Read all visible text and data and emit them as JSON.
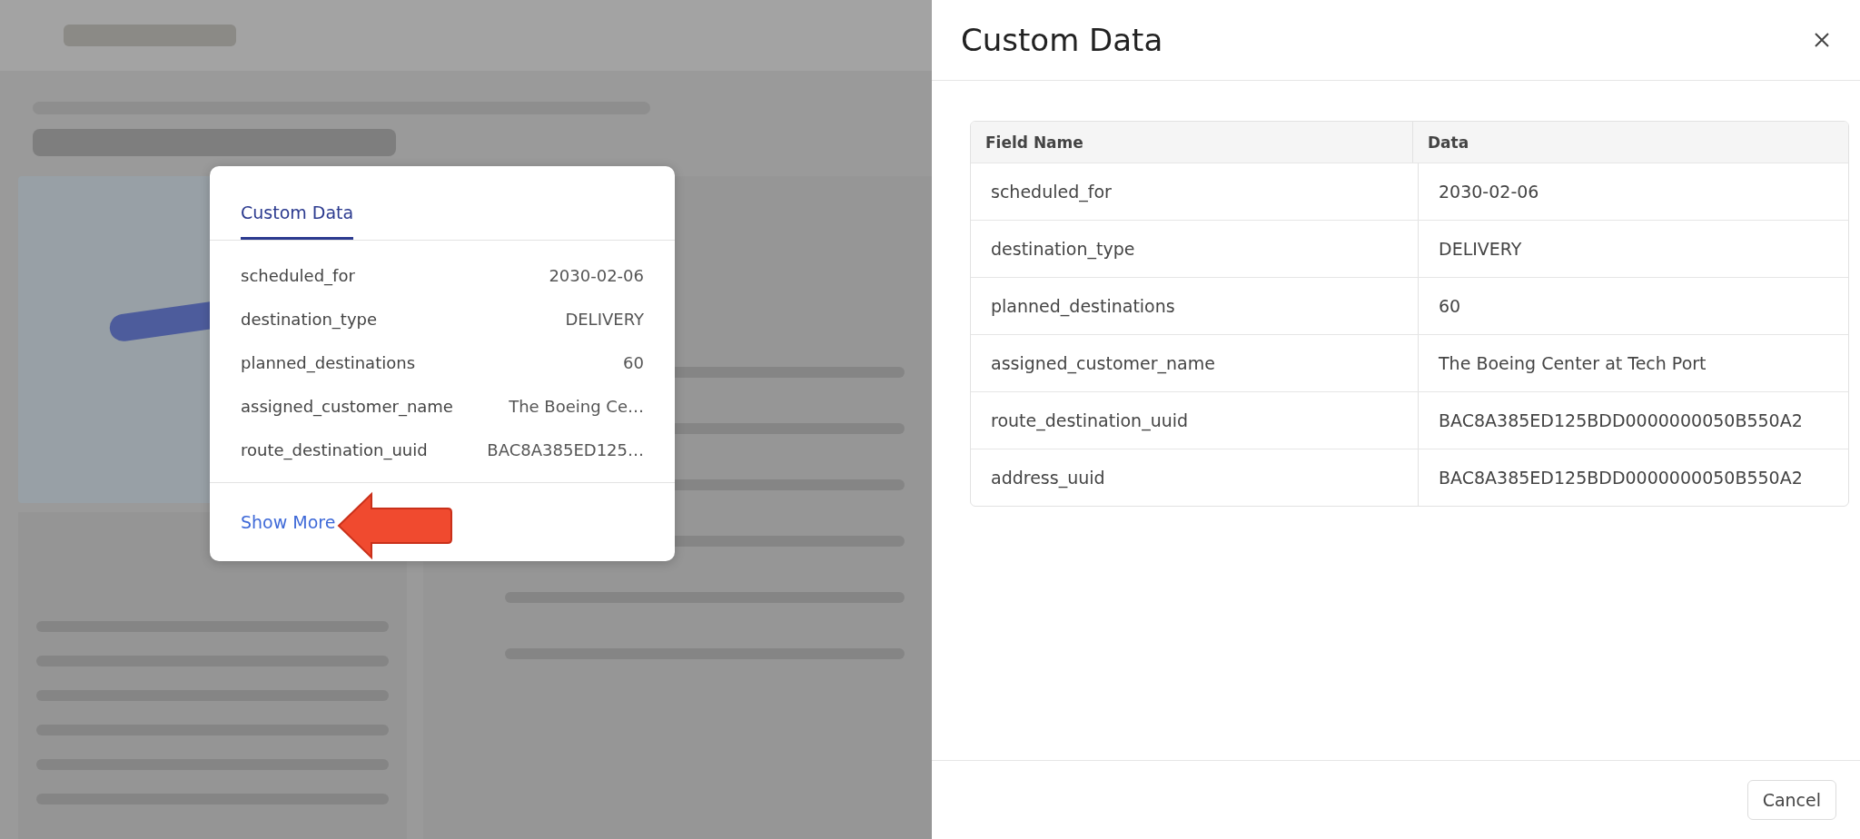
{
  "popover": {
    "tabs": [
      {
        "label": "Custom Data",
        "selected": true
      }
    ],
    "rows": [
      {
        "name": "scheduled_for",
        "value": "2030-02-06"
      },
      {
        "name": "destination_type",
        "value": "DELIVERY"
      },
      {
        "name": "planned_destinations",
        "value": "60"
      },
      {
        "name": "assigned_customer_name",
        "value": "The Boeing Ce…"
      },
      {
        "name": "route_destination_uuid",
        "value": "BAC8A385ED125…"
      }
    ],
    "link": "Show More"
  },
  "panel": {
    "title": "Custom Data",
    "table": {
      "columns": [
        "Field Name",
        "Data"
      ],
      "rows": [
        [
          "scheduled_for",
          "2030-02-06"
        ],
        [
          "destination_type",
          "DELIVERY"
        ],
        [
          "planned_destinations",
          "60"
        ],
        [
          "assigned_customer_name",
          "The Boeing Center at Tech Port"
        ],
        [
          "route_destination_uuid",
          "BAC8A385ED125BDD0000000050B550A2"
        ],
        [
          "address_uuid",
          "BAC8A385ED125BDD0000000050B550A2"
        ]
      ]
    },
    "buttons": [
      "Cancel"
    ]
  }
}
